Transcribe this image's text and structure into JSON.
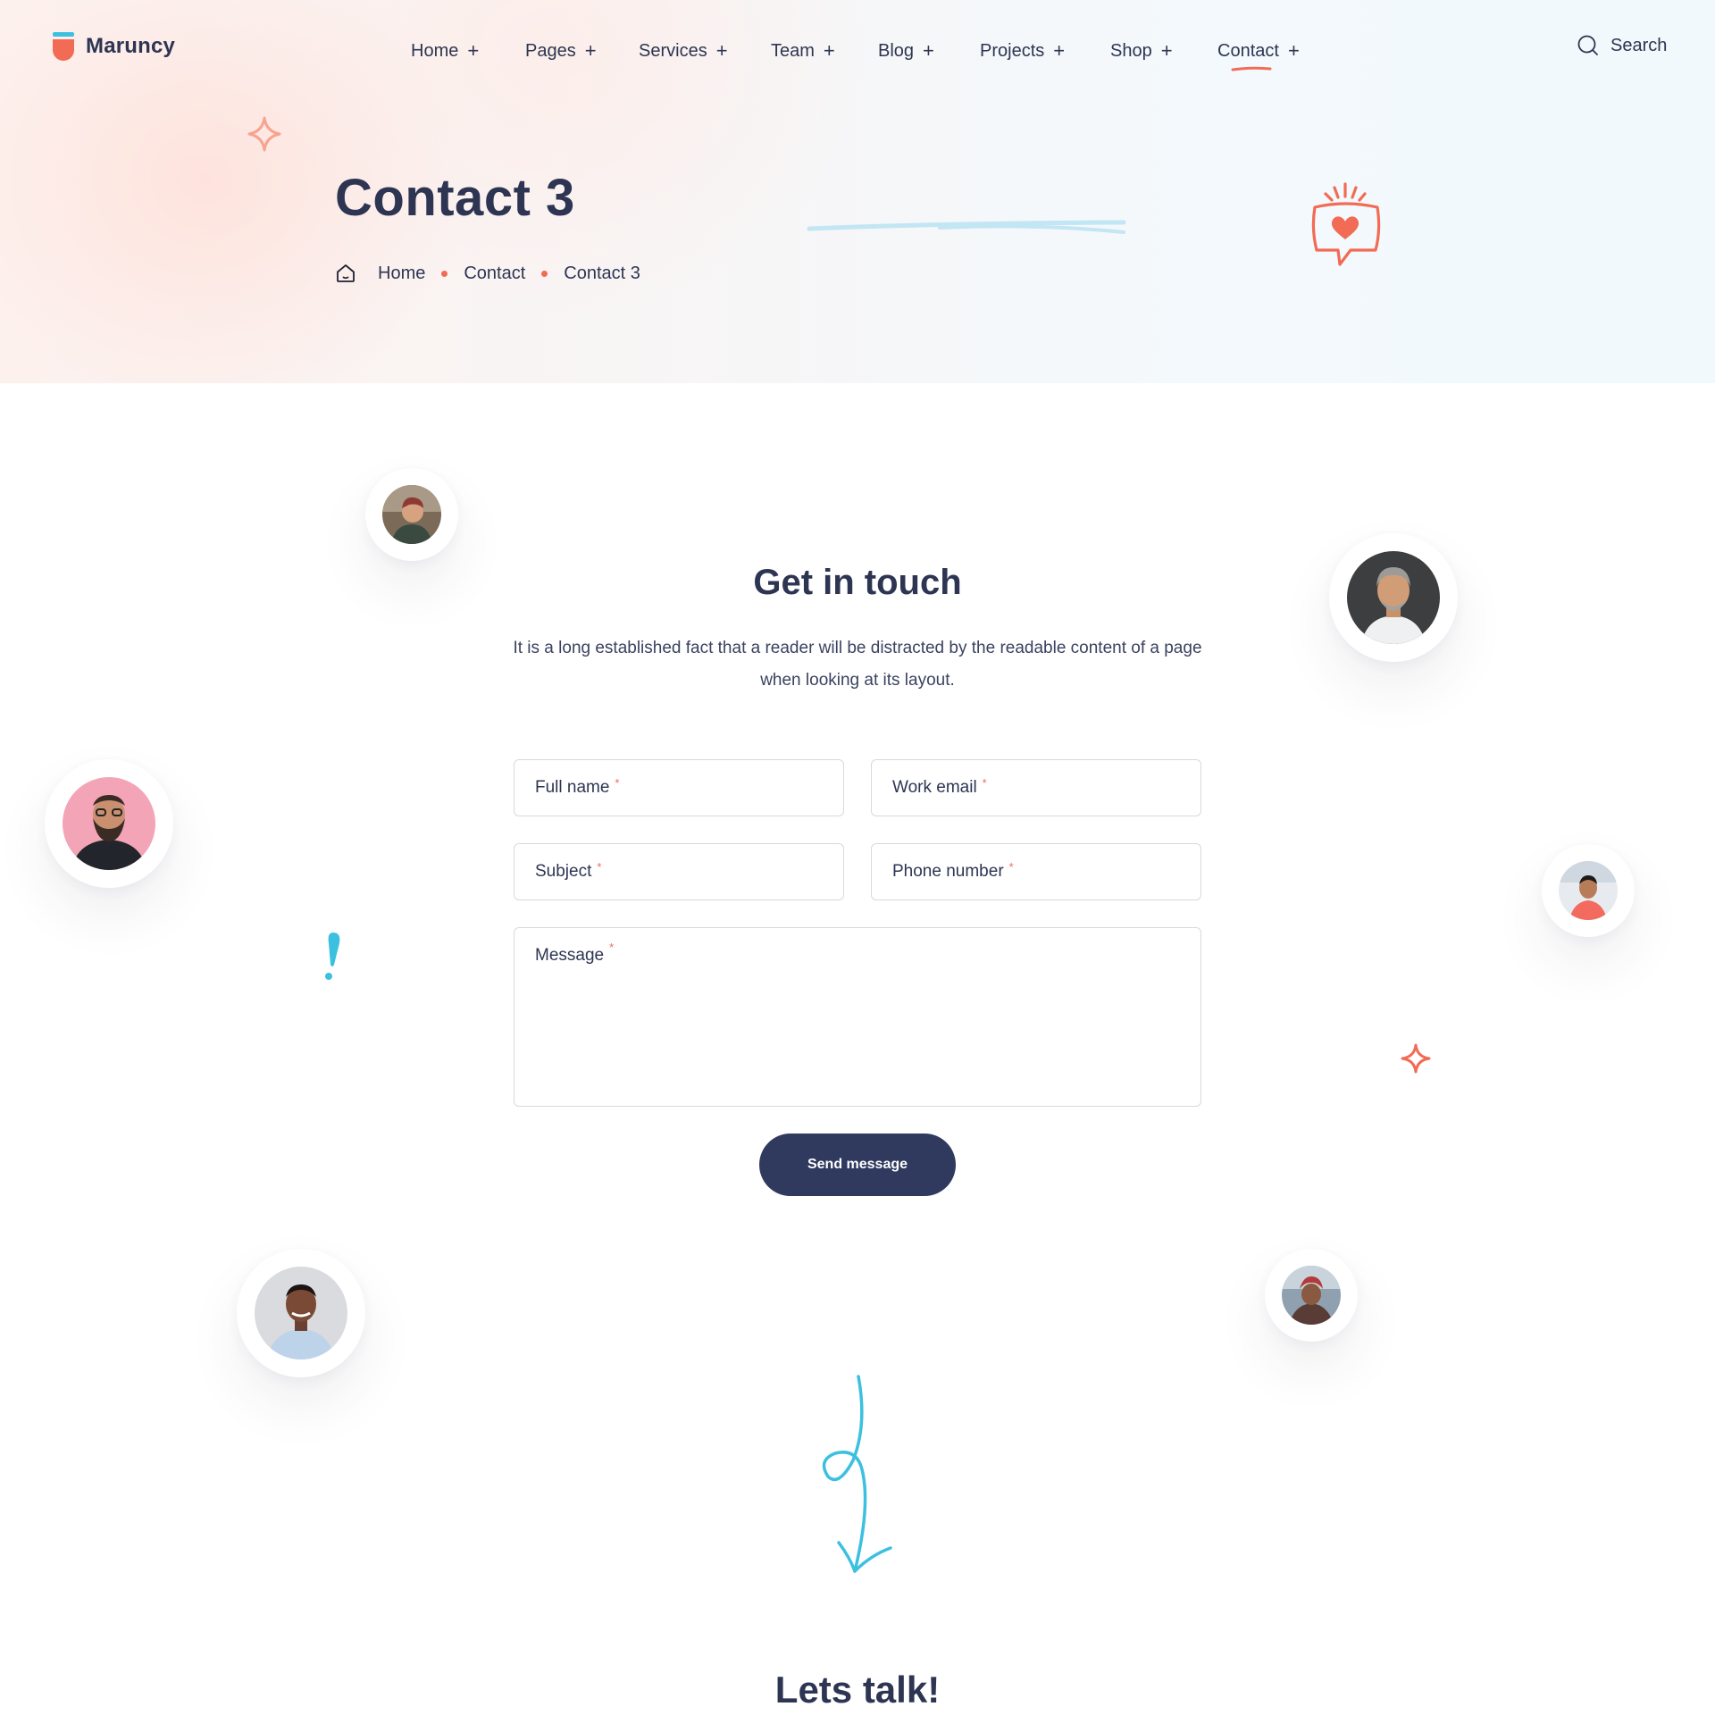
{
  "brand": {
    "name": "Maruncy"
  },
  "nav": {
    "items": [
      {
        "label": "Home",
        "active": false
      },
      {
        "label": "Pages",
        "active": false
      },
      {
        "label": "Services",
        "active": false
      },
      {
        "label": "Team",
        "active": false
      },
      {
        "label": "Blog",
        "active": false
      },
      {
        "label": "Projects",
        "active": false
      },
      {
        "label": "Shop",
        "active": false
      },
      {
        "label": "Contact",
        "active": true
      }
    ],
    "expand_glyph": "+",
    "search_label": "Search"
  },
  "hero": {
    "title": "Contact 3",
    "breadcrumb": [
      "Home",
      "Contact",
      "Contact 3"
    ]
  },
  "contact": {
    "title": "Get in touch",
    "description": "It is a long established fact that a reader will be distracted by the readable content of a page when looking at its layout.",
    "fields": {
      "full_name": {
        "placeholder": "Full name",
        "required_mark": "*"
      },
      "work_email": {
        "placeholder": "Work email",
        "required_mark": "*"
      },
      "subject": {
        "placeholder": "Subject",
        "required_mark": "*"
      },
      "phone": {
        "placeholder": "Phone number",
        "required_mark": "*"
      },
      "message": {
        "placeholder": "Message",
        "required_mark": "*"
      }
    },
    "submit_label": "Send message"
  },
  "talk": {
    "title": "Lets talk!"
  },
  "colors": {
    "primary": "#2d3552",
    "button": "#2f3a5e",
    "accent_coral": "#f26b54",
    "accent_blue": "#3cc0e0",
    "light_blue": "#c3e6f4"
  }
}
